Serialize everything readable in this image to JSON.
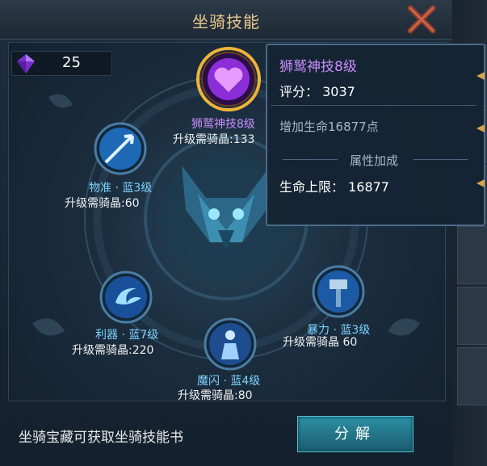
{
  "title": "坐骑技能",
  "currency": {
    "icon": "purple-gem-icon",
    "value": "25"
  },
  "skills": [
    {
      "name": "狮鹫神技8级",
      "cost": "升级需骑晶:133",
      "icon": "purple-heart-icon",
      "selected": true
    },
    {
      "name": "物准 · 蓝3级",
      "cost": "升级需骑晶:60",
      "icon": "arrow-icon"
    },
    {
      "name": "利器 · 蓝7级",
      "cost": "升级需骑晶:220",
      "icon": "swirl-blade-icon"
    },
    {
      "name": "魔闪 · 蓝4级",
      "cost": "升级需骑晶:80",
      "icon": "glowing-figure-icon"
    },
    {
      "name": "暴力 · 蓝3级",
      "cost": "升级需骑晶 60",
      "icon": "hammer-icon"
    }
  ],
  "tooltip": {
    "title": "狮鹫神技8级",
    "score": "评分： 3037",
    "desc": "增加生命16877点",
    "attr_title": "属性加成",
    "attr": "生命上限： 16877"
  },
  "bottom": {
    "hint": "坐骑宝藏可获取坐骑技能书",
    "decompose_label": "分解"
  },
  "colors": {
    "title": "#e7c98a",
    "skill_name": "#7fd4ff",
    "selected_name": "#c98dfc",
    "button": "#2d8fa4"
  }
}
